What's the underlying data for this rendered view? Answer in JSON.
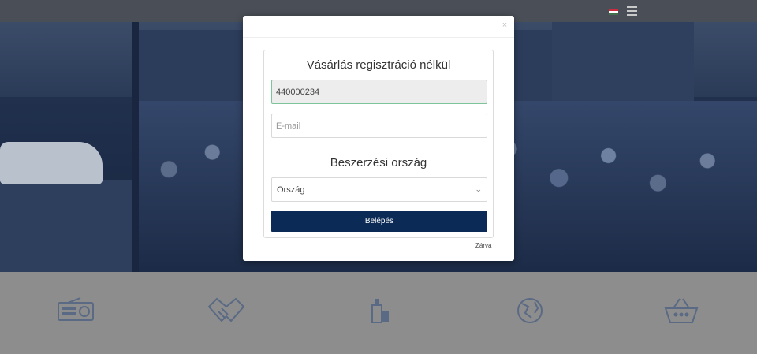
{
  "header": {
    "flag_colors": [
      "#cd2a3e",
      "#ffffff",
      "#436f4d"
    ]
  },
  "features": {
    "icons": [
      "radio-icon",
      "handshake-icon",
      "bottles-icon",
      "globe-icon",
      "basket-icon"
    ]
  },
  "modal": {
    "close_symbol": "×",
    "title": "Vásárlás regisztráció nélkül",
    "code_value": "440000234",
    "email_placeholder": "E-mail",
    "country_title": "Beszerzési ország",
    "country_selected": "Ország",
    "submit_label": "Belépés",
    "close_label": "Zárva"
  },
  "colors": {
    "accent": "#0b2a56",
    "valid_border": "#7ec49a"
  }
}
